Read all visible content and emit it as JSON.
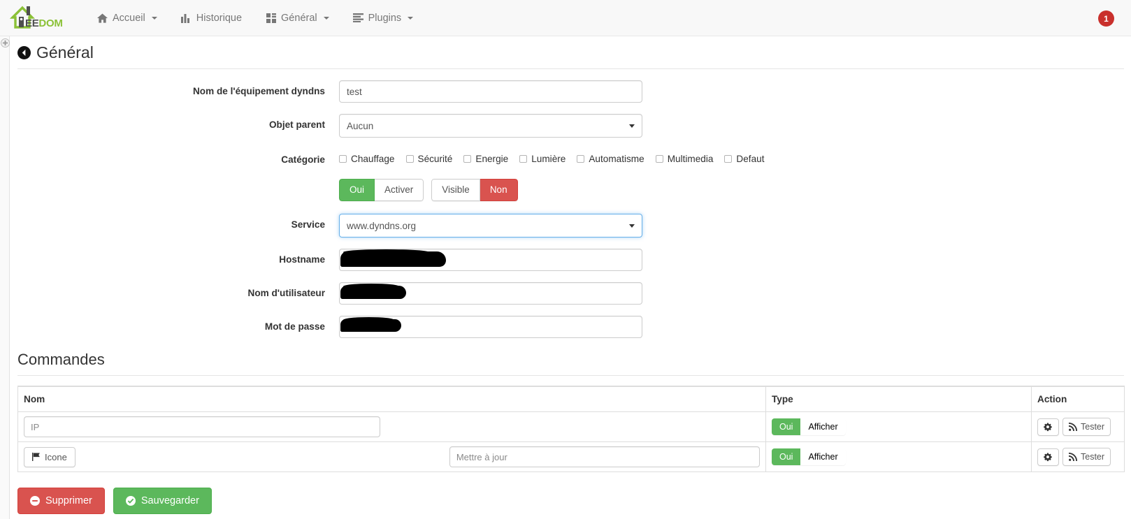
{
  "navbar": {
    "brand": {
      "prefix_icon": "jeedom-house-logo",
      "text_ee": "EE",
      "text_dom": "DOM"
    },
    "items": [
      {
        "label": "Accueil",
        "icon": "home-icon",
        "has_caret": true
      },
      {
        "label": "Historique",
        "icon": "chart-bar-icon",
        "has_caret": false
      },
      {
        "label": "Général",
        "icon": "th-large-icon",
        "has_caret": true
      },
      {
        "label": "Plugins",
        "icon": "list-icon",
        "has_caret": true
      }
    ],
    "notification_count": "1",
    "notification_color": "#c9302c"
  },
  "page": {
    "title": "Général",
    "back_icon": "arrow-circle-left-icon",
    "rail_icon": "plus-circle-icon"
  },
  "form": {
    "rows": [
      {
        "label": "Nom de l'équipement dyndns",
        "type": "text",
        "value": "test",
        "placeholder": ""
      },
      {
        "label": "Objet parent",
        "type": "select",
        "value": "Aucun"
      },
      {
        "label": "Catégorie",
        "type": "checkboxes"
      },
      {
        "label": "",
        "type": "toggles"
      },
      {
        "label": "Service",
        "type": "select",
        "value": "www.dyndns.org",
        "focused": true
      },
      {
        "label": "Hostname",
        "type": "redacted",
        "redact": "r1"
      },
      {
        "label": "Nom d'utilisateur",
        "type": "redacted",
        "redact": "r2"
      },
      {
        "label": "Mot de passe",
        "type": "redacted",
        "redact": "r3"
      }
    ],
    "categories": [
      {
        "label": "Chauffage",
        "checked": false
      },
      {
        "label": "Sécurité",
        "checked": false
      },
      {
        "label": "Energie",
        "checked": false
      },
      {
        "label": "Lumière",
        "checked": false
      },
      {
        "label": "Automatisme",
        "checked": false
      },
      {
        "label": "Multimedia",
        "checked": false
      },
      {
        "label": "Defaut",
        "checked": false
      }
    ],
    "toggle_groups": [
      {
        "buttons": [
          {
            "label": "Oui",
            "state": "active-green"
          },
          {
            "label": "Activer",
            "state": "inactive"
          }
        ]
      },
      {
        "buttons": [
          {
            "label": "Visible",
            "state": "inactive"
          },
          {
            "label": "Non",
            "state": "active-red"
          }
        ]
      }
    ]
  },
  "commands": {
    "title": "Commandes",
    "columns": {
      "nom": "Nom",
      "type": "Type",
      "action": "Action"
    },
    "rows": [
      {
        "name_placeholder": "IP",
        "name_value": "",
        "has_icon_button": false,
        "update_placeholder": "",
        "type_buttons": [
          {
            "label": "Oui",
            "state": "active-green"
          },
          {
            "label": "Afficher",
            "state": "inactive"
          }
        ],
        "action_config_icon": "cogs-icon",
        "action_test_icon": "rss-icon",
        "action_test_label": "Tester"
      },
      {
        "name_placeholder": "",
        "name_value": "",
        "has_icon_button": true,
        "icon_button_label": "Icone",
        "icon_button_icon": "flag-icon",
        "update_placeholder": "Mettre à jour",
        "type_buttons": [
          {
            "label": "Oui",
            "state": "active-green"
          },
          {
            "label": "Afficher",
            "state": "inactive"
          }
        ],
        "action_config_icon": "cogs-icon",
        "action_test_icon": "rss-icon",
        "action_test_label": "Tester"
      }
    ]
  },
  "footer": {
    "delete_label": "Supprimer",
    "delete_icon": "minus-circle-icon",
    "save_label": "Sauvegarder",
    "save_icon": "check-circle-icon"
  },
  "colors": {
    "green": "#5cb85c",
    "red": "#d9534f",
    "brand_green": "#8bc137",
    "focus_blue": "#66afe9"
  }
}
